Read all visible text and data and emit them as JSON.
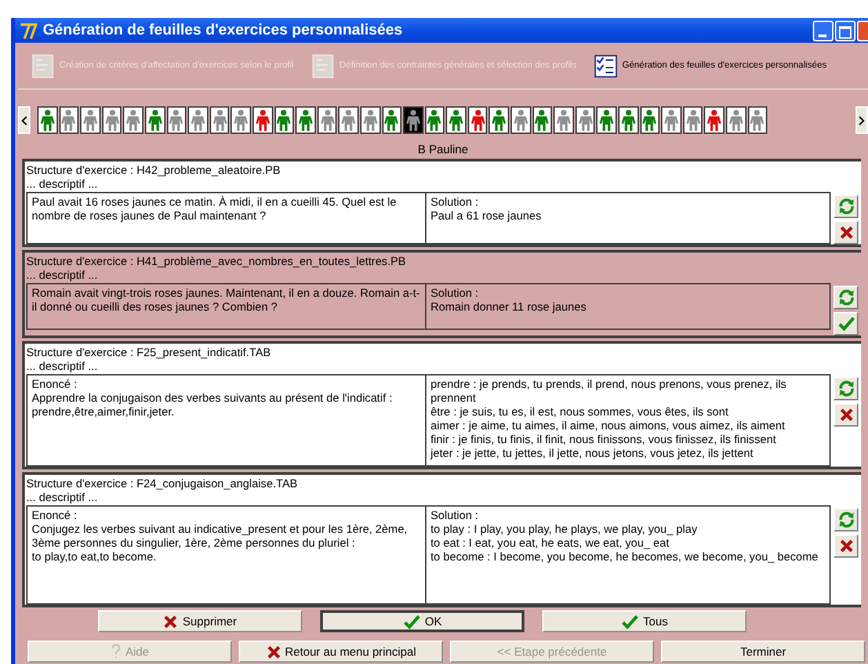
{
  "window": {
    "title": "Génération de feuilles d'exercices personnalisées"
  },
  "steps": [
    {
      "label": "Création de critères d'affectation d'exercices selon le profil",
      "disabled": true
    },
    {
      "label": "Définition des contraintes générales et sélection des profils",
      "disabled": true
    },
    {
      "label": "Génération des feuilles d'exercices personnalisées",
      "disabled": false
    }
  ],
  "students": [
    {
      "color": "#108010",
      "selected": false
    },
    {
      "color": "#909090",
      "selected": false
    },
    {
      "color": "#909090",
      "selected": false
    },
    {
      "color": "#909090",
      "selected": false
    },
    {
      "color": "#909090",
      "selected": false
    },
    {
      "color": "#108010",
      "selected": false
    },
    {
      "color": "#909090",
      "selected": false
    },
    {
      "color": "#909090",
      "selected": false
    },
    {
      "color": "#909090",
      "selected": false
    },
    {
      "color": "#909090",
      "selected": false
    },
    {
      "color": "#e01010",
      "selected": false
    },
    {
      "color": "#108010",
      "selected": false
    },
    {
      "color": "#108010",
      "selected": false
    },
    {
      "color": "#909090",
      "selected": false
    },
    {
      "color": "#909090",
      "selected": false
    },
    {
      "color": "#909090",
      "selected": false
    },
    {
      "color": "#108010",
      "selected": false
    },
    {
      "color": "#909090",
      "selected": true
    },
    {
      "color": "#108010",
      "selected": false
    },
    {
      "color": "#108010",
      "selected": false
    },
    {
      "color": "#e01010",
      "selected": false
    },
    {
      "color": "#108010",
      "selected": false
    },
    {
      "color": "#909090",
      "selected": false
    },
    {
      "color": "#108010",
      "selected": false
    },
    {
      "color": "#909090",
      "selected": false
    },
    {
      "color": "#909090",
      "selected": false
    },
    {
      "color": "#108010",
      "selected": false
    },
    {
      "color": "#108010",
      "selected": false
    },
    {
      "color": "#108010",
      "selected": false
    },
    {
      "color": "#909090",
      "selected": false
    },
    {
      "color": "#909090",
      "selected": false
    },
    {
      "color": "#e01010",
      "selected": false
    },
    {
      "color": "#909090",
      "selected": false
    },
    {
      "color": "#909090",
      "selected": false
    }
  ],
  "student_name": "B Pauline",
  "exercises": [
    {
      "structure": "Structure d'exercice : H42_probleme_aleatoire.PB",
      "description": "... descriptif ...",
      "statement": [
        "Paul avait 16 roses jaunes ce matin. À midi, il en a cueilli 45. Quel est le nombre de roses jaunes de Paul maintenant ?"
      ],
      "solution": [
        "Solution :",
        "Paul a 61 rose jaunes"
      ],
      "selected": false
    },
    {
      "structure": "Structure d'exercice : H41_problème_avec_nombres_en_toutes_lettres.PB",
      "description": "... descriptif ...",
      "statement": [
        "Romain avait vingt-trois roses jaunes. Maintenant, il en a douze. Romain a-t-il donné ou cueilli des roses jaunes ? Combien ?"
      ],
      "solution": [
        "Solution :",
        "Romain donner 11 rose jaunes"
      ],
      "selected": true
    },
    {
      "structure": "Structure d'exercice : F25_present_indicatif.TAB",
      "description": "... descriptif ...",
      "statement": [
        "Enoncé :",
        "Apprendre la conjugaison des verbes suivants au présent de l'indicatif : prendre,être,aimer,finir,jeter."
      ],
      "solution": [
        "prendre :  je prends, tu prends, il prend, nous prenons, vous prenez, ils prennent",
        "être :  je suis, tu es, il est, nous sommes, vous êtes, ils sont",
        "aimer :  je aime, tu aimes, il aime, nous aimons, vous aimez, ils aiment",
        "finir :  je finis, tu finis, il finit, nous finissons, vous finissez, ils finissent",
        "jeter :  je jette, tu jettes, il jette, nous jetons, vous jetez, ils jettent"
      ],
      "selected": false
    },
    {
      "structure": "Structure d'exercice : F24_conjugaison_anglaise.TAB",
      "description": "... descriptif ...",
      "statement": [
        "Enoncé :",
        "Conjugez les verbes suivant au indicative_present et pour les 1ère, 2ème, 3ème personnes du singulier, 1ère, 2ème personnes du pluriel :",
        "to play,to eat,to become."
      ],
      "solution": [
        "Solution :",
        "to play :  I play, you play, he plays, we play, you_ play",
        "to eat :  I eat, you eat, he eats, we eat, you_ eat",
        "to become :  I become, you become, he becomes, we become, you_ become"
      ],
      "selected": false
    }
  ],
  "actions": [
    {
      "label": "Supprimer",
      "kind": "delete",
      "default": false
    },
    {
      "label": "OK",
      "kind": "ok",
      "default": true
    },
    {
      "label": "Tous",
      "kind": "ok",
      "default": false
    }
  ],
  "navigation": [
    {
      "label": "Aide",
      "kind": "help",
      "disabled": true
    },
    {
      "label": "Retour au menu principal",
      "kind": "delete",
      "disabled": false
    },
    {
      "label": "<< Etape précédente",
      "kind": "none",
      "disabled": true
    },
    {
      "label": "Terminer",
      "kind": "none",
      "disabled": false
    }
  ]
}
